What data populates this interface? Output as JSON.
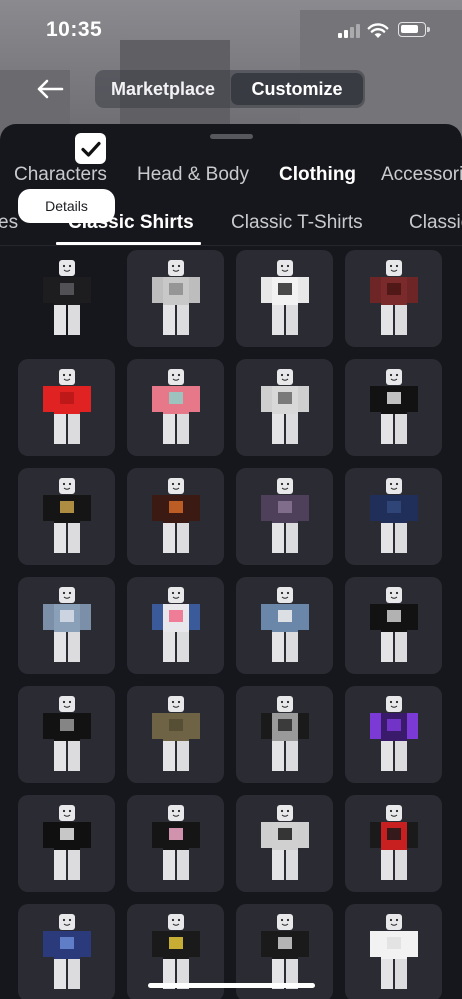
{
  "status": {
    "time": "10:35"
  },
  "nav": {
    "segments": [
      "Marketplace",
      "Customize"
    ],
    "active_segment": "Customize"
  },
  "categories": [
    "Characters",
    "Head & Body",
    "Clothing",
    "Accessories"
  ],
  "active_category": "Clothing",
  "subcategories": [
    "es",
    "Classic Shirts",
    "Classic T-Shirts",
    "Classic Pants"
  ],
  "active_subcategory": "Classic Shirts",
  "details_label": "Details",
  "icons": [
    "back-arrow-icon",
    "cellular-signal-icon",
    "wifi-icon",
    "battery-icon",
    "checkmark-icon"
  ],
  "items": [
    {
      "shirt": "#1d1d20",
      "accent": "#5a5a60",
      "sleeve": "#1d1d20",
      "selected": true
    },
    {
      "shirt": "#c8c8c8",
      "accent": "#8d8d8d",
      "sleeve": "#bdbdbd"
    },
    {
      "shirt": "#f2f2f2",
      "accent": "#2a2a2a",
      "sleeve": "#e8e8e8"
    },
    {
      "shirt": "#7a2a2a",
      "accent": "#4a1515",
      "sleeve": "#6e2525"
    },
    {
      "shirt": "#e02222",
      "accent": "#b81616",
      "sleeve": "#e02222"
    },
    {
      "shirt": "#e6788a",
      "accent": "#8fd0c8",
      "sleeve": "#e6788a"
    },
    {
      "shirt": "#d8d8d8",
      "accent": "#6a6a6a",
      "sleeve": "#cfcfcf"
    },
    {
      "shirt": "#121212",
      "accent": "#e0e0e0",
      "sleeve": "#121212"
    },
    {
      "shirt": "#151515",
      "accent": "#c9a24a",
      "sleeve": "#151515"
    },
    {
      "shirt": "#3a1a12",
      "accent": "#d46a2a",
      "sleeve": "#3a1a12"
    },
    {
      "shirt": "#4e3f5a",
      "accent": "#8a7595",
      "sleeve": "#4e3f5a"
    },
    {
      "shirt": "#1f2f5a",
      "accent": "#34497c",
      "sleeve": "#1f2f5a"
    },
    {
      "shirt": "#8a9fb8",
      "accent": "#d6dde6",
      "sleeve": "#7b8fa8"
    },
    {
      "shirt": "#e8e8ec",
      "accent": "#f06a8a",
      "sleeve": "#3a5a9a"
    },
    {
      "shirt": "#6a86a8",
      "accent": "#f0f0f0",
      "sleeve": "#6a86a8"
    },
    {
      "shirt": "#121212",
      "accent": "#cfcfcf",
      "sleeve": "#121212"
    },
    {
      "shirt": "#121212",
      "accent": "#9a9a9a",
      "sleeve": "#121212"
    },
    {
      "shirt": "#6f6346",
      "accent": "#534a34",
      "sleeve": "#6f6346"
    },
    {
      "shirt": "#9a9a9a",
      "accent": "#2a2a2a",
      "sleeve": "#1a1a1a"
    },
    {
      "shirt": "#3a1a6a",
      "accent": "#7b3ad6",
      "sleeve": "#7b3ad6"
    },
    {
      "shirt": "#101010",
      "accent": "#e8e8e8",
      "sleeve": "#101010"
    },
    {
      "shirt": "#151515",
      "accent": "#f2a8c8",
      "sleeve": "#151515"
    },
    {
      "shirt": "#d0d0d0",
      "accent": "#1a1a1a",
      "sleeve": "#cfcfcf"
    },
    {
      "shirt": "#c82020",
      "accent": "#1a1a1a",
      "sleeve": "#1a1a1a"
    },
    {
      "shirt": "#2a3a7a",
      "accent": "#6a8ad6",
      "sleeve": "#2a3a7a"
    },
    {
      "shirt": "#1a1a1a",
      "accent": "#e8c83a",
      "sleeve": "#1a1a1a"
    },
    {
      "shirt": "#1a1a1a",
      "accent": "#d0d0d0",
      "sleeve": "#1a1a1a"
    },
    {
      "shirt": "#f2f2f2",
      "accent": "#e0e0e0",
      "sleeve": "#f2f2f2"
    }
  ]
}
